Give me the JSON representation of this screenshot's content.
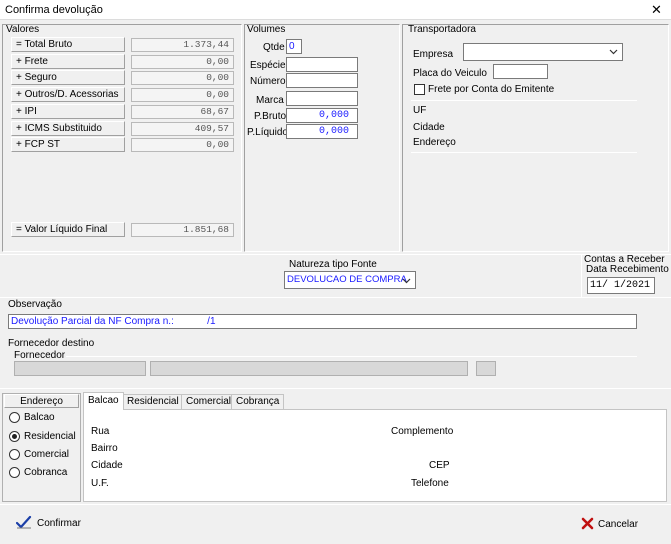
{
  "window": {
    "title": "Confirma devolução",
    "close_glyph": "✕"
  },
  "valores": {
    "group_label": "Valores",
    "rows": [
      {
        "label": "= Total Bruto",
        "value": "1.373,44"
      },
      {
        "label": "+ Frete",
        "value": "0,00"
      },
      {
        "label": "+ Seguro",
        "value": "0,00"
      },
      {
        "label": "+ Outros/D. Acessorias",
        "value": "0,00"
      },
      {
        "label": "+ IPI",
        "value": "68,67"
      },
      {
        "label": "+ ICMS Substituido",
        "value": "409,57"
      },
      {
        "label": "+ FCP ST",
        "value": "0,00"
      }
    ],
    "liquido": {
      "label": "= Valor Líquido Final",
      "value": "1.851,68"
    }
  },
  "volumes": {
    "group_label": "Volumes",
    "qtde_label": "Qtde",
    "qtde_value": "0",
    "especie_label": "Espécie",
    "especie_value": "",
    "numero_label": "Número",
    "numero_value": "",
    "marca_label": "Marca",
    "marca_value": "",
    "pbruto_label": "P.Bruto",
    "pbruto_value": "0,000",
    "pliquido_label": "P.Líquido",
    "pliquido_value": "0,000"
  },
  "transportadora": {
    "group_label": "Transportadora",
    "empresa_label": "Empresa",
    "empresa_value": "",
    "placa_label": "Placa do Veiculo",
    "placa_value": "",
    "frete_label": "Frete por Conta do Emitente",
    "frete_checked": false,
    "uf_label": "UF",
    "cidade_label": "Cidade",
    "endereco_label": "Endereço"
  },
  "natureza": {
    "label": "Natureza  tipo Fonte",
    "value": "DEVOLUCAO DE COMPRA"
  },
  "contas": {
    "label1": "Contas a Receber",
    "label2": "Data Recebimento",
    "date_value": "11/ 1/2021"
  },
  "observacao": {
    "label": "Observação",
    "value": "Devolução Parcial da NF Compra n.:            /1"
  },
  "fornecedor": {
    "group_label": "Fornecedor destino",
    "sub_label": "Fornecedor"
  },
  "endereco": {
    "header": "Endereço",
    "options": [
      {
        "label": "Balcao",
        "selected": false
      },
      {
        "label": "Residencial",
        "selected": true
      },
      {
        "label": "Comercial",
        "selected": false
      },
      {
        "label": "Cobranca",
        "selected": false
      }
    ]
  },
  "tabs": [
    "Balcao",
    "Residencial",
    "Comercial",
    "Cobrança"
  ],
  "address_fields": {
    "rua": "Rua",
    "bairro": "Bairro",
    "cidade": "Cidade",
    "uf": "U.F.",
    "complemento": "Complemento",
    "cep": "CEP",
    "telefone": "Telefone"
  },
  "buttons": {
    "confirmar": "Confirmar",
    "cancelar": "Cancelar"
  },
  "icons": {
    "confirm": "checkmark-pen-icon",
    "cancel": "red-x-icon",
    "dropdown": "chevron-down-icon"
  }
}
